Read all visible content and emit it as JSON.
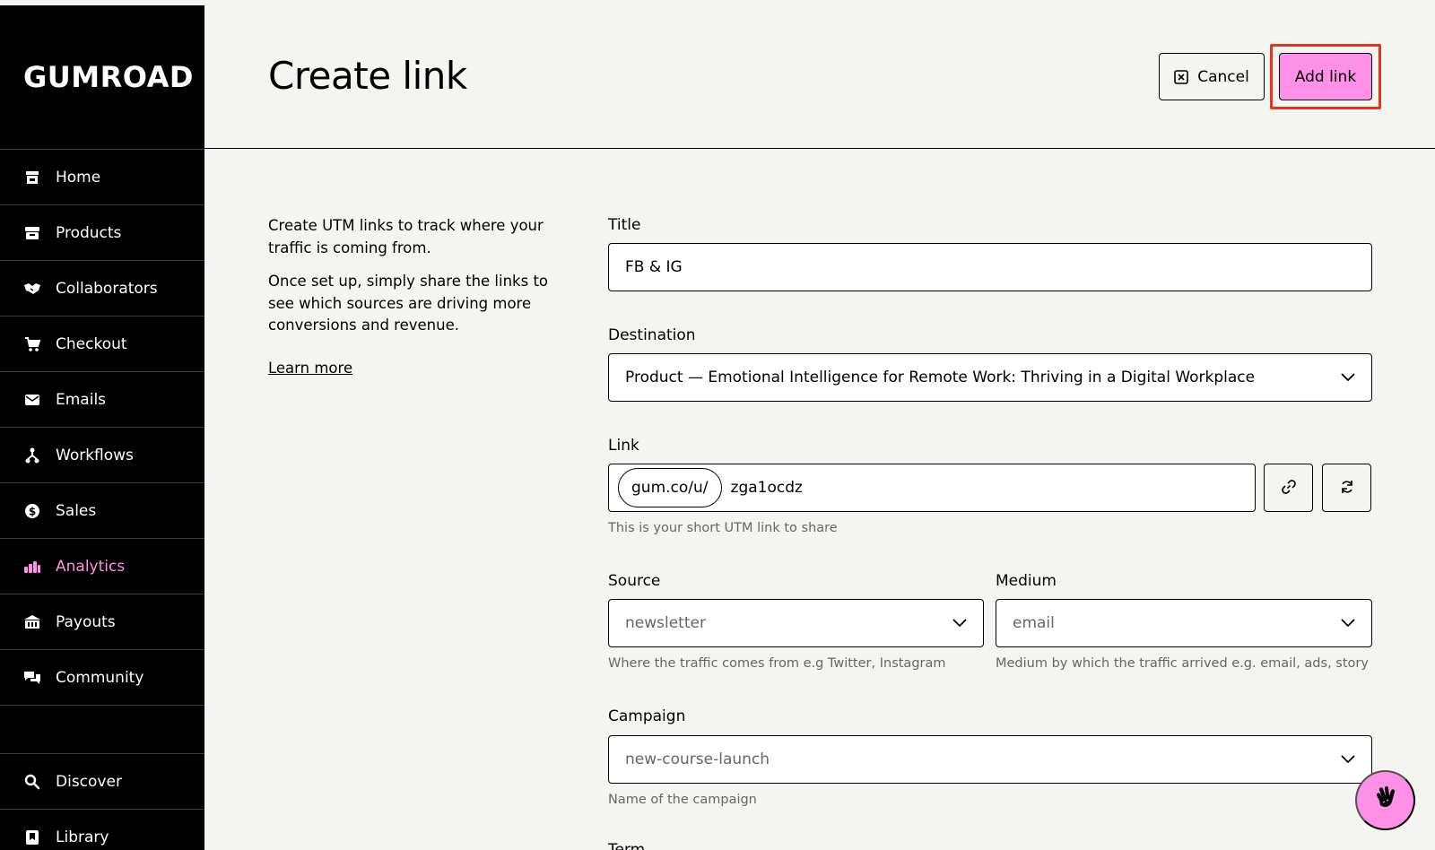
{
  "brand": {
    "logo_text": "GUMROAD"
  },
  "sidebar": {
    "items": [
      {
        "label": "Home",
        "icon": "shop-icon"
      },
      {
        "label": "Products",
        "icon": "archive-icon"
      },
      {
        "label": "Collaborators",
        "icon": "handshake-icon"
      },
      {
        "label": "Checkout",
        "icon": "cart-icon"
      },
      {
        "label": "Emails",
        "icon": "envelope-icon"
      },
      {
        "label": "Workflows",
        "icon": "workflow-icon"
      },
      {
        "label": "Sales",
        "icon": "dollar-circle-icon"
      },
      {
        "label": "Analytics",
        "icon": "bar-chart-icon",
        "active": true
      },
      {
        "label": "Payouts",
        "icon": "bank-icon"
      },
      {
        "label": "Community",
        "icon": "chat-bubbles-icon"
      }
    ],
    "bottom_items": [
      {
        "label": "Discover",
        "icon": "search-icon"
      },
      {
        "label": "Library",
        "icon": "bookmark-icon"
      }
    ]
  },
  "header": {
    "title": "Create link",
    "cancel_label": "Cancel",
    "add_label": "Add link"
  },
  "intro": {
    "paragraph1": "Create UTM links to track where your traffic is coming from.",
    "paragraph2": "Once set up, simply share the links to see which sources are driving more conversions and revenue.",
    "learn_more": "Learn more"
  },
  "form": {
    "title": {
      "label": "Title",
      "value": "FB & IG"
    },
    "destination": {
      "label": "Destination",
      "value": "Product — Emotional Intelligence for Remote Work: Thriving in a Digital Workplace"
    },
    "link": {
      "label": "Link",
      "prefix": "gum.co/u/",
      "value": "zga1ocdz",
      "hint": "This is your short UTM link to share"
    },
    "source": {
      "label": "Source",
      "placeholder": "newsletter",
      "hint": "Where the traffic comes from e.g Twitter, Instagram"
    },
    "medium": {
      "label": "Medium",
      "placeholder": "email",
      "hint": "Medium by which the traffic arrived e.g. email, ads, story"
    },
    "campaign": {
      "label": "Campaign",
      "placeholder": "new-course-launch",
      "hint": "Name of the campaign"
    },
    "term": {
      "label": "Term"
    }
  },
  "colors": {
    "accent": "#ff90e8",
    "highlight": "#e8341c",
    "sidebar_bg": "#000000",
    "page_bg": "#f4f4f0"
  }
}
